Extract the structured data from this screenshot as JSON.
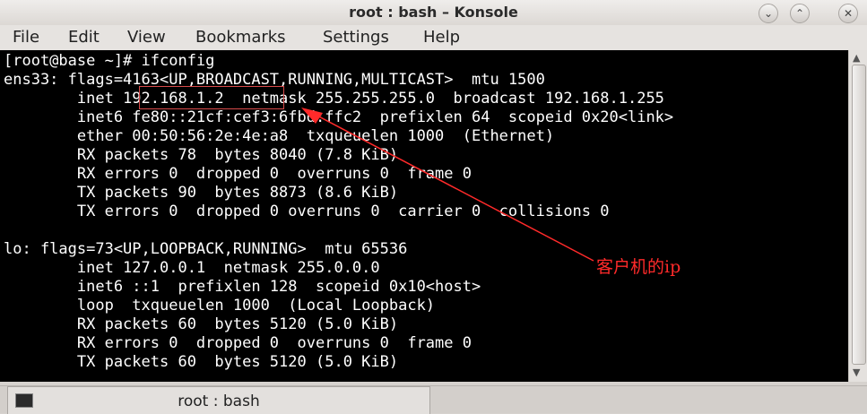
{
  "window": {
    "title": "root : bash – Konsole",
    "controls": [
      "minimize",
      "maximize",
      "close"
    ]
  },
  "menu": [
    "File",
    "Edit",
    "View",
    "Bookmarks",
    "Settings",
    "Help"
  ],
  "terminal": {
    "lines": [
      "[root@base ~]# ifconfig",
      "ens33: flags=4163<UP,BROADCAST,RUNNING,MULTICAST>  mtu 1500",
      "        inet 192.168.1.2  netmask 255.255.255.0  broadcast 192.168.1.255",
      "        inet6 fe80::21cf:cef3:6fbd:ffc2  prefixlen 64  scopeid 0x20<link>",
      "        ether 00:50:56:2e:4e:a8  txqueuelen 1000  (Ethernet)",
      "        RX packets 78  bytes 8040 (7.8 KiB)",
      "        RX errors 0  dropped 0  overruns 0  frame 0",
      "        TX packets 90  bytes 8873 (8.6 KiB)",
      "        TX errors 0  dropped 0 overruns 0  carrier 0  collisions 0",
      "",
      "lo: flags=73<UP,LOOPBACK,RUNNING>  mtu 65536",
      "        inet 127.0.0.1  netmask 255.0.0.0",
      "        inet6 ::1  prefixlen 128  scopeid 0x10<host>",
      "        loop  txqueuelen 1000  (Local Loopback)",
      "        RX packets 60  bytes 5120 (5.0 KiB)",
      "        RX errors 0  dropped 0  overruns 0  frame 0",
      "        TX packets 60  bytes 5120 (5.0 KiB)"
    ]
  },
  "annotation": {
    "label": "客户机的ip",
    "color": "#ff2a2a"
  },
  "tab": {
    "label": "root : bash",
    "icon": "terminal-icon"
  },
  "colors": {
    "terminal_bg": "#000000",
    "terminal_fg": "#ffffff",
    "chrome": "#e6e3e0"
  }
}
